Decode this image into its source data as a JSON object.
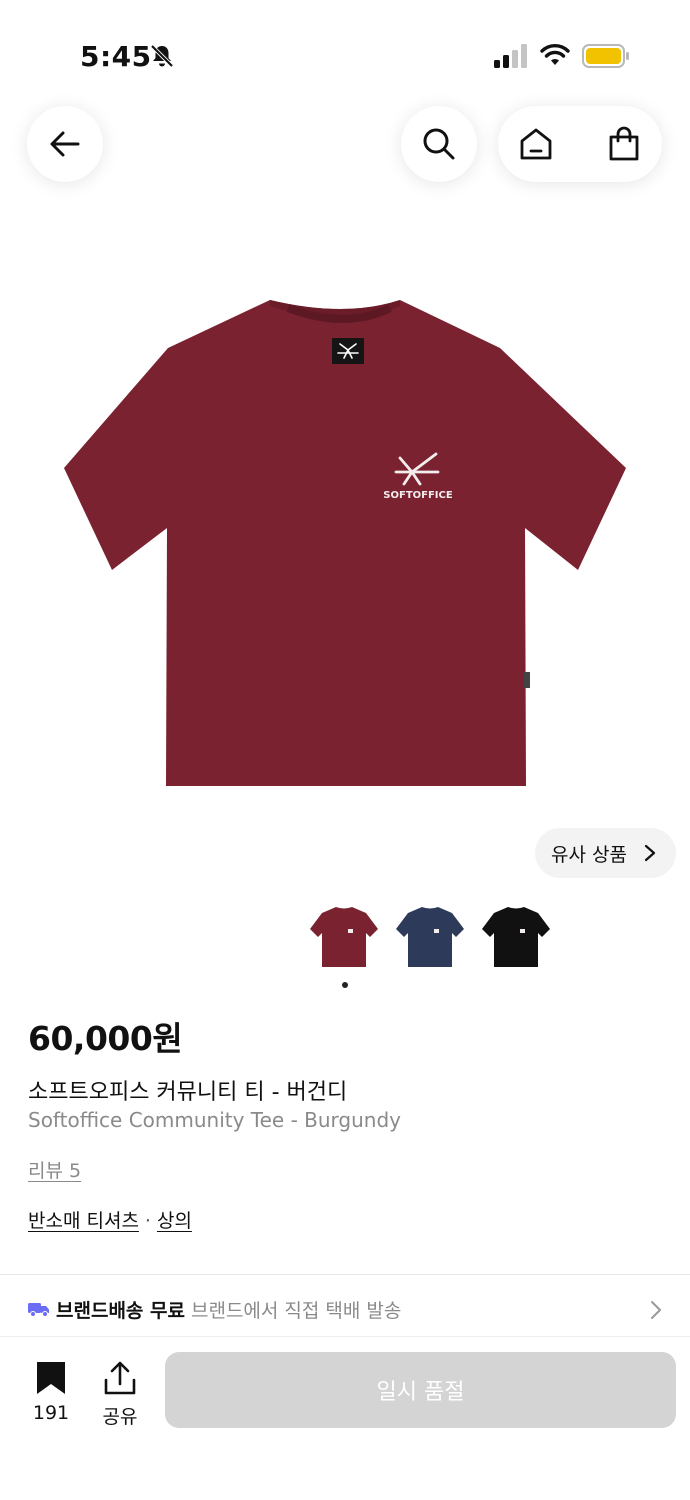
{
  "status_bar": {
    "time": "5:45"
  },
  "nav": {
    "icons": [
      "arrow-left-icon",
      "search-icon",
      "home-icon",
      "shopping-bag-icon"
    ]
  },
  "product": {
    "image_colors": {
      "shirt": "#7a2230",
      "logo_text": "SOFTOFFICE"
    },
    "similar_label": "유사 상품",
    "swatches": [
      {
        "name": "burgundy",
        "color": "#7a2230"
      },
      {
        "name": "navy",
        "color": "#2e3a5a"
      },
      {
        "name": "black",
        "color": "#111111"
      }
    ],
    "price": "60,000원",
    "title_ko": "소프트오피스 커뮤니티 티 - 버건디",
    "title_en": "Softoffice Community Tee - Burgundy",
    "review": "리뷰 5",
    "category_primary": "반소매 티셔츠",
    "category_separator": "·",
    "category_secondary": "상의"
  },
  "shipping": {
    "strong": "브랜드배송 무료",
    "desc": "브랜드에서 직접 택배 발송",
    "icon_color": "#6b6ef5"
  },
  "bottom": {
    "bookmark_count": "191",
    "share_label": "공유",
    "cta_label": "일시 품절",
    "cta_color": "#d4d4d4"
  }
}
